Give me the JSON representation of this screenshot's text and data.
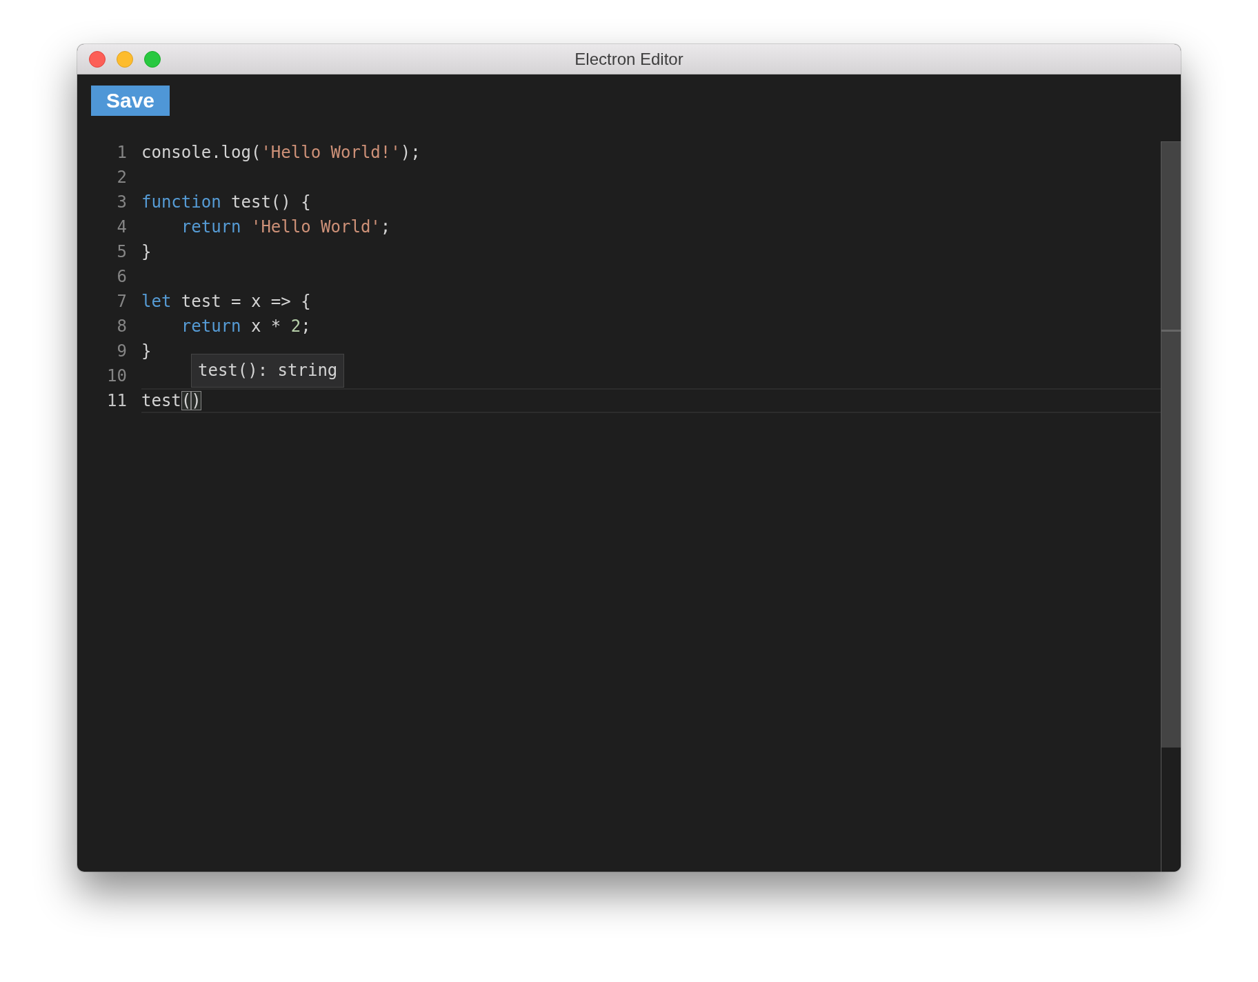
{
  "window": {
    "title": "Electron Editor"
  },
  "toolbar": {
    "save_button": "Save"
  },
  "editor": {
    "lines": [
      {
        "number": "1",
        "current": false,
        "tokens": [
          {
            "kind": "plain",
            "text": "console.log("
          },
          {
            "kind": "string",
            "text": "'Hello World!'"
          },
          {
            "kind": "plain",
            "text": ");"
          }
        ]
      },
      {
        "number": "2",
        "current": false
      },
      {
        "number": "3",
        "current": false,
        "tokens": [
          {
            "kind": "keyword",
            "text": "function"
          },
          {
            "kind": "plain",
            "text": " test() {"
          }
        ]
      },
      {
        "number": "4",
        "current": false,
        "tokens": [
          {
            "kind": "keyword",
            "text": "    return "
          },
          {
            "kind": "string",
            "text": "'Hello World'"
          },
          {
            "kind": "plain",
            "text": ";"
          }
        ]
      },
      {
        "number": "5",
        "current": false,
        "tokens": [
          {
            "kind": "plain",
            "text": "}"
          }
        ]
      },
      {
        "number": "6",
        "current": false
      },
      {
        "number": "7",
        "current": false,
        "tokens": [
          {
            "kind": "keyword",
            "text": "let"
          },
          {
            "kind": "plain",
            "text": " test = x => {"
          }
        ]
      },
      {
        "number": "8",
        "current": false,
        "tokens": [
          {
            "kind": "keyword",
            "text": "    return"
          },
          {
            "kind": "plain",
            "text": " x * "
          },
          {
            "kind": "number",
            "text": "2"
          },
          {
            "kind": "plain",
            "text": ";"
          }
        ]
      },
      {
        "number": "9",
        "current": false,
        "tokens": [
          {
            "kind": "plain",
            "text": "}"
          }
        ]
      },
      {
        "number": "10",
        "current": false
      },
      {
        "number": "11",
        "current": true,
        "tokens": [
          {
            "kind": "plain",
            "text": "test"
          },
          {
            "kind": "matched-bracket",
            "text": "("
          },
          {
            "kind": "cursor"
          },
          {
            "kind": "matched-bracket",
            "text": ")"
          }
        ]
      }
    ],
    "tooltip": {
      "text": "test(): string"
    }
  }
}
